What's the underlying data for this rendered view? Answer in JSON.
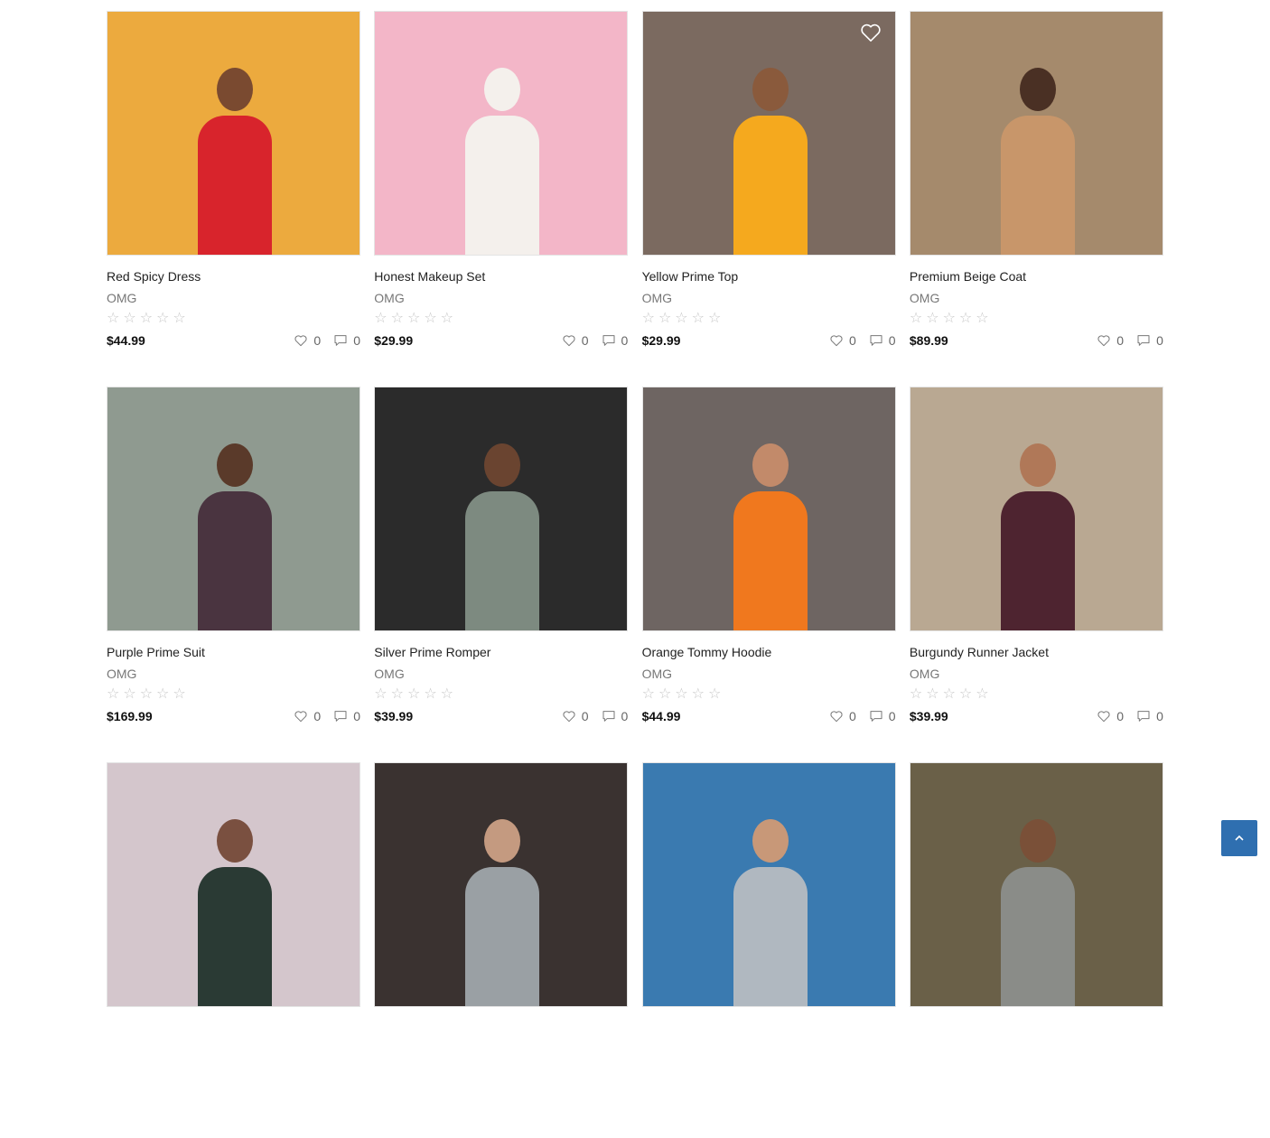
{
  "products": [
    {
      "title": "Red Spicy Dress",
      "brand": "OMG",
      "price": "$44.99",
      "likes": "0",
      "comments": "0",
      "bg": "#ecaa3e",
      "fig_color": "#d8242c",
      "skin": "#7a4a30",
      "wish_visible": false
    },
    {
      "title": "Honest Makeup Set",
      "brand": "OMG",
      "price": "$29.99",
      "likes": "0",
      "comments": "0",
      "bg": "#f3b6c8",
      "fig_color": "#f4f0ec",
      "skin": "#f4f0ec",
      "wish_visible": false
    },
    {
      "title": "Yellow Prime Top",
      "brand": "OMG",
      "price": "$29.99",
      "likes": "0",
      "comments": "0",
      "bg": "#7b6a60",
      "fig_color": "#f5a91e",
      "skin": "#8a5a3c",
      "wish_visible": true
    },
    {
      "title": "Premium Beige Coat",
      "brand": "OMG",
      "price": "$89.99",
      "likes": "0",
      "comments": "0",
      "bg": "#a58a6c",
      "fig_color": "#c8966a",
      "skin": "#4a3024",
      "wish_visible": false
    },
    {
      "title": "Purple Prime Suit",
      "brand": "OMG",
      "price": "$169.99",
      "likes": "0",
      "comments": "0",
      "bg": "#8f9a90",
      "fig_color": "#4a3440",
      "skin": "#5a3a2a",
      "wish_visible": false
    },
    {
      "title": "Silver Prime Romper",
      "brand": "OMG",
      "price": "$39.99",
      "likes": "0",
      "comments": "0",
      "bg": "#2b2b2b",
      "fig_color": "#7d8a80",
      "skin": "#6a4430",
      "wish_visible": false
    },
    {
      "title": "Orange Tommy Hoodie",
      "brand": "OMG",
      "price": "$44.99",
      "likes": "0",
      "comments": "0",
      "bg": "#6e6562",
      "fig_color": "#f0781e",
      "skin": "#c28a6a",
      "wish_visible": false
    },
    {
      "title": "Burgundy Runner Jacket",
      "brand": "OMG",
      "price": "$39.99",
      "likes": "0",
      "comments": "0",
      "bg": "#b9a892",
      "fig_color": "#4e2430",
      "skin": "#b07858",
      "wish_visible": false
    },
    {
      "title": "",
      "brand": "",
      "price": "",
      "likes": "",
      "comments": "",
      "bg": "#d4c6cc",
      "fig_color": "#2a3a34",
      "skin": "#7a5040",
      "wish_visible": false
    },
    {
      "title": "",
      "brand": "",
      "price": "",
      "likes": "",
      "comments": "",
      "bg": "#3a3230",
      "fig_color": "#9aa0a4",
      "skin": "#c49a80",
      "wish_visible": false
    },
    {
      "title": "",
      "brand": "",
      "price": "",
      "likes": "",
      "comments": "",
      "bg": "#3a7ab0",
      "fig_color": "#b0b8c0",
      "skin": "#c89878",
      "wish_visible": false
    },
    {
      "title": "",
      "brand": "",
      "price": "",
      "likes": "",
      "comments": "",
      "bg": "#6a6048",
      "fig_color": "#8a8c88",
      "skin": "#7a5038",
      "wish_visible": false
    }
  ],
  "icons": {
    "rating_star": "star-outline-icon",
    "like": "heart-outline-icon",
    "comment": "comment-icon",
    "wishlist": "heart-outline-icon",
    "scroll_top": "chevron-up-icon"
  },
  "colors": {
    "accent": "#2f6fb0",
    "star": "#c7c7c7"
  }
}
